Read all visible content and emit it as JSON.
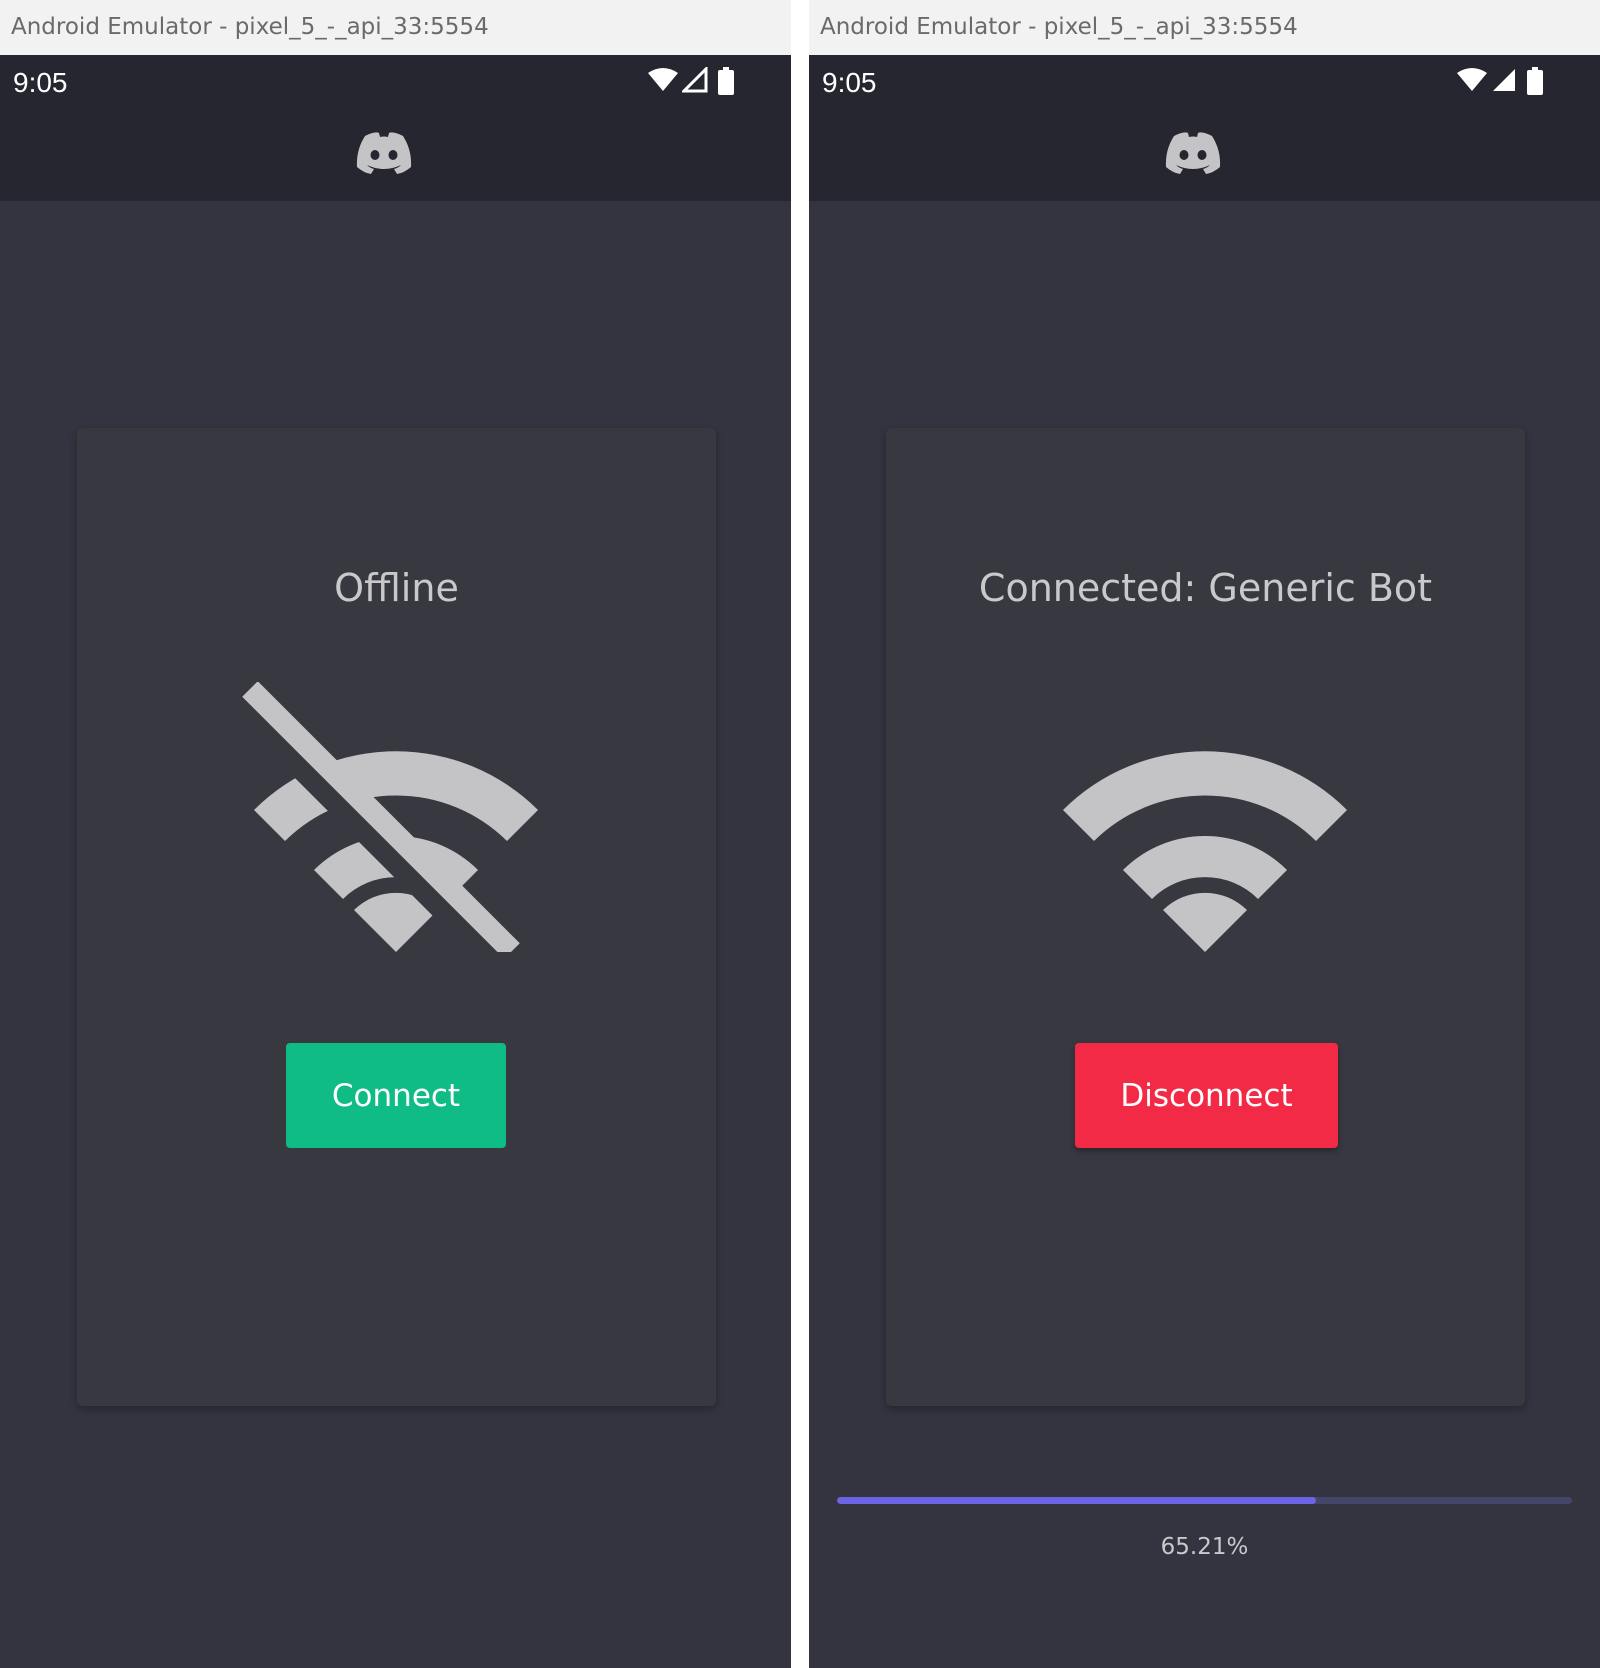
{
  "left_window": {
    "title": "Android Emulator - pixel_5_-_api_33:5554",
    "status_time": "9:05",
    "card": {
      "status": "Offline",
      "icon": "wifi-off-icon",
      "button_label": "Connect",
      "button_color": "#10bc85"
    }
  },
  "right_window": {
    "title": "Android Emulator - pixel_5_-_api_33:5554",
    "status_time": "9:05",
    "card": {
      "status": "Connected: Generic Bot",
      "icon": "wifi-icon",
      "button_label": "Disconnect",
      "button_color": "#f22a46"
    },
    "progress": {
      "fraction": 0.6521,
      "label": "65.21%",
      "fill_color": "#6b65e6",
      "track_color": "#45456a"
    }
  },
  "colors": {
    "app_background": "#343440",
    "app_bar": "#262630",
    "card": "#383841",
    "icon": "#c4c4c6",
    "window_title_bar": "#f2f2f2"
  }
}
